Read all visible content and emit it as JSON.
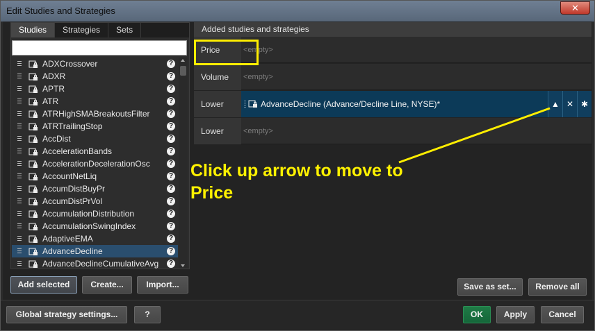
{
  "window": {
    "title": "Edit Studies and Strategies",
    "close_label": "✕"
  },
  "tabs": [
    {
      "label": "Studies",
      "active": true
    },
    {
      "label": "Strategies",
      "active": false
    },
    {
      "label": "Sets",
      "active": false
    }
  ],
  "search": {
    "value": ""
  },
  "studies": [
    "ADXCrossover",
    "ADXR",
    "APTR",
    "ATR",
    "ATRHighSMABreakoutsFilter",
    "ATRTrailingStop",
    "AccDist",
    "AccelerationBands",
    "AccelerationDecelerationOsc",
    "AccountNetLiq",
    "AccumDistBuyPr",
    "AccumDistPrVol",
    "AccumulationDistribution",
    "AccumulationSwingIndex",
    "AdaptiveEMA",
    "AdvanceDecline",
    "AdvanceDeclineCumulativeAvg"
  ],
  "selected_study": "AdvanceDecline",
  "help_glyph": "?",
  "left_buttons": {
    "add_selected": "Add selected",
    "create": "Create...",
    "import": "Import..."
  },
  "added": {
    "header": "Added studies and strategies",
    "slots": [
      {
        "label": "Price",
        "value": "<empty>"
      },
      {
        "label": "Volume",
        "value": "<empty>"
      },
      {
        "label": "Lower",
        "value": "AdvanceDecline (Advance/Decline Line, NYSE)*"
      },
      {
        "label": "Lower",
        "value": "<empty>"
      }
    ],
    "move_up_glyph": "▲",
    "remove_glyph": "✕",
    "settings_glyph": "✱"
  },
  "right_buttons": {
    "save_as_set": "Save as set...",
    "remove_all": "Remove all"
  },
  "annotation": {
    "line1": "Click up arrow to move to",
    "line2": "Price"
  },
  "footer": {
    "global_settings": "Global strategy settings...",
    "help": "?",
    "ok": "OK",
    "apply": "Apply",
    "cancel": "Cancel"
  },
  "colors": {
    "accent_highlight": "#ffee00",
    "selection": "#2a4e6e",
    "ok_green": "#1f7a45"
  }
}
